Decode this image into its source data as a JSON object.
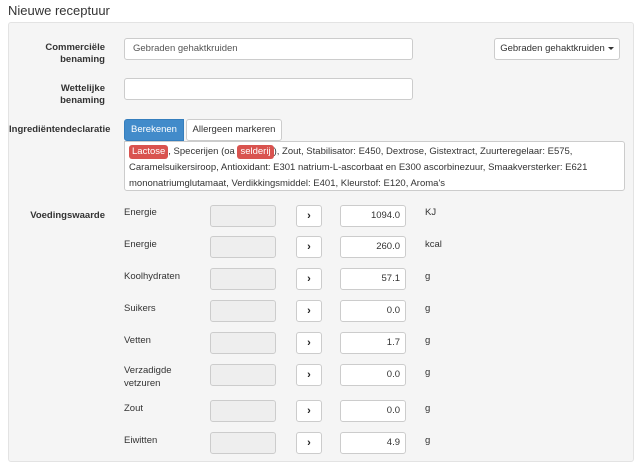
{
  "page_title": "Nieuwe receptuur",
  "form": {
    "commercial_label": "Commerciële benaming",
    "commercial_value": "Gebraden gehaktkruiden",
    "dropdown_label": "Gebraden gehaktkruiden",
    "legal_label": "Wettelijke benaming",
    "legal_value": "",
    "ingredients_label": "Ingrediëntendeclaratie",
    "calc_button": "Berekenen",
    "allergen_button": "Allergeen markeren",
    "declaration": {
      "badge1": "Lactose",
      "text1": ", Specerijen (oa ",
      "badge2": "selderij",
      "text2": "), Zout, Stabilisator: E450, Dextrose, Gistextract, Zuurteregelaar: E575, Caramelsuikersiroop, Antioxidant: E301 natrium-L-ascorbaat en E300 ascorbinezuur, Smaakversterker: E621 mononatriumglutamaat, Verdikkingsmiddel: E401, Kleurstof: E120, Aroma's"
    },
    "nutrition_label": "Voedingswaarde"
  },
  "nutrients": [
    {
      "name": "Energie",
      "value": "1094.0",
      "unit": "KJ"
    },
    {
      "name": "Energie",
      "value": "260.0",
      "unit": "kcal"
    },
    {
      "name": "Koolhydraten",
      "value": "57.1",
      "unit": "g"
    },
    {
      "name": "Suikers",
      "value": "0.0",
      "unit": "g"
    },
    {
      "name": "Vetten",
      "value": "1.7",
      "unit": "g"
    },
    {
      "name": "Verzadigde vetzuren",
      "value": "0.0",
      "unit": "g"
    },
    {
      "name": "Zout",
      "value": "0.0",
      "unit": "g"
    },
    {
      "name": "Eiwitten",
      "value": "4.9",
      "unit": "g"
    }
  ],
  "icons": {
    "arrow": "chevron-right-icon",
    "caret": "caret-down-icon"
  }
}
